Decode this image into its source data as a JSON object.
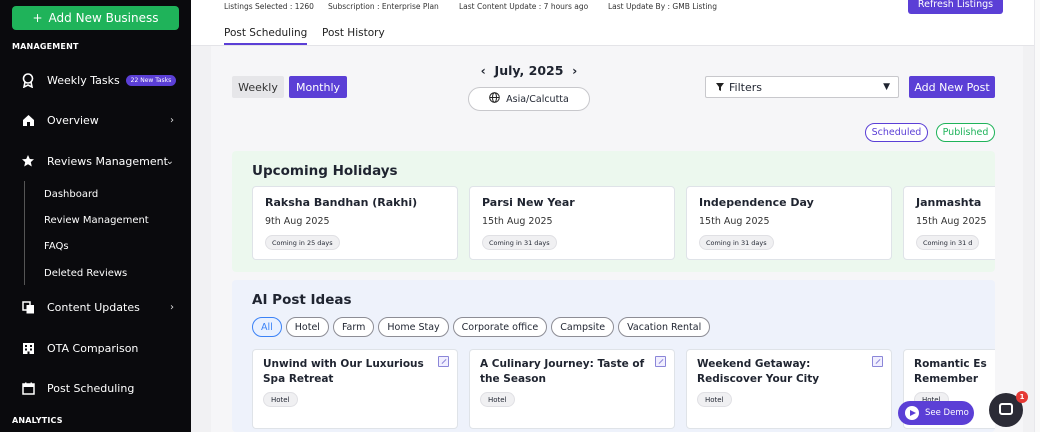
{
  "sidebar": {
    "add_business": "Add New Business",
    "section_management": "MANAGEMENT",
    "section_analytics": "ANALYTICS",
    "items": [
      {
        "label": "Weekly Tasks",
        "badge": "22 New Tasks",
        "icon": "award-icon"
      },
      {
        "label": "Overview",
        "icon": "home-icon",
        "chevron": "›"
      },
      {
        "label": "Reviews Management",
        "icon": "star-icon",
        "chevron": "⌄"
      },
      {
        "label": "Content Updates",
        "icon": "copy-icon",
        "chevron": "›"
      },
      {
        "label": "OTA Comparison",
        "icon": "building-icon"
      },
      {
        "label": "Post Scheduling",
        "icon": "calendar-icon"
      }
    ],
    "subitems": [
      "Dashboard",
      "Review Management",
      "FAQs",
      "Deleted Reviews"
    ]
  },
  "topbar": {
    "listings": "Listings Selected : 1260",
    "subscription": "Subscription : Enterprise Plan",
    "last_content": "Last Content Update : 7 hours ago",
    "last_update_by": "Last Update By : GMB Listing",
    "refresh": "Refresh Listings"
  },
  "tabs": [
    "Post Scheduling",
    "Post History"
  ],
  "toolbar": {
    "weekly": "Weekly",
    "monthly": "Monthly",
    "month": "July, 2025",
    "prev": "‹",
    "next": "›",
    "timezone": "Asia/Calcutta",
    "filters": "Filters",
    "add_post": "Add New Post",
    "scheduled": "Scheduled",
    "published": "Published"
  },
  "holidays": {
    "title": "Upcoming Holidays",
    "cards": [
      {
        "name": "Raksha Bandhan (Rakhi)",
        "date": "9th Aug 2025",
        "coming": "Coming in 25 days"
      },
      {
        "name": "Parsi New Year",
        "date": "15th Aug 2025",
        "coming": "Coming in 31 days"
      },
      {
        "name": "Independence Day",
        "date": "15th Aug 2025",
        "coming": "Coming in 31 days"
      },
      {
        "name": "Janmashta",
        "date": "15th Aug 2025",
        "coming": "Coming in 31 d"
      }
    ]
  },
  "ai": {
    "title": "AI Post Ideas",
    "categories": [
      "All",
      "Hotel",
      "Farm",
      "Home Stay",
      "Corporate office",
      "Campsite",
      "Vacation Rental"
    ],
    "cards": [
      {
        "title": "Unwind with Our Luxurious Spa Retreat",
        "tag": "Hotel"
      },
      {
        "title": "A Culinary Journey: Taste of the Season",
        "tag": "Hotel"
      },
      {
        "title": "Weekend Getaway: Rediscover Your City",
        "tag": "Hotel"
      },
      {
        "title": "Romantic Es Remember",
        "tag": "Hotel"
      }
    ]
  },
  "widgets": {
    "see_demo": "See Demo",
    "chat_count": "1"
  },
  "colors": {
    "accent": "#5b3fd6",
    "green": "#1fb35a",
    "sidebar": "#0a0a0d"
  }
}
